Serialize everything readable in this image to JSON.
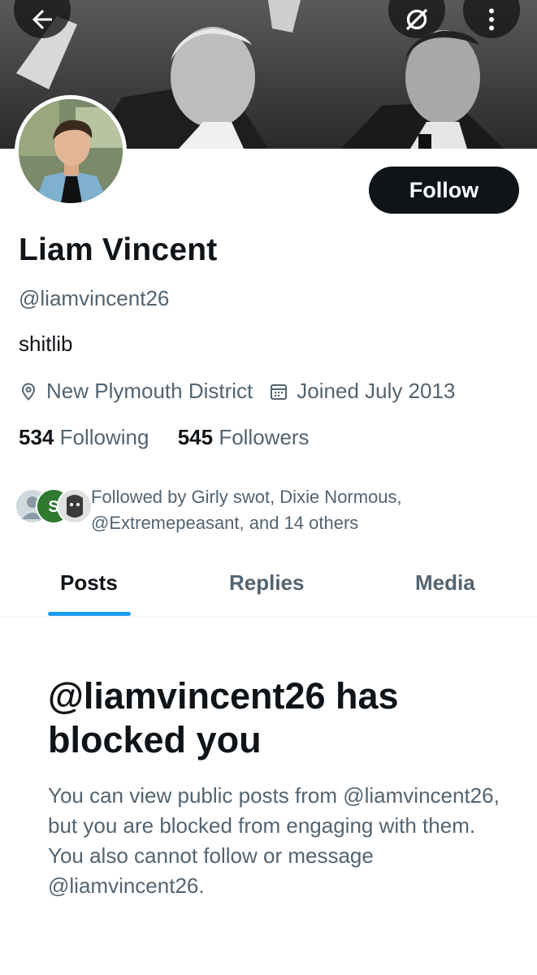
{
  "header": {
    "back_icon": "arrow-left-icon",
    "grok_icon": "grok-icon",
    "more_icon": "more-vertical-icon"
  },
  "profile": {
    "display_name": "Liam Vincent",
    "handle": "@liamvincent26",
    "bio": "shitlib",
    "location": "New Plymouth District",
    "joined": "Joined July 2013",
    "following_count": "534",
    "following_label": "Following",
    "followers_count": "545",
    "followers_label": "Followers",
    "follow_button": "Follow",
    "followed_by_text": "Followed by Girly swot, Dixie Normous, @Extremepeasant, and 14 others"
  },
  "tabs": [
    {
      "label": "Posts",
      "active": true
    },
    {
      "label": "Replies",
      "active": false
    },
    {
      "label": "Media",
      "active": false
    }
  ],
  "blocked": {
    "title": "@liamvincent26 has blocked you",
    "body": "You can view public posts from @liamvincent26, but you are blocked from engaging with them. You also cannot follow or message @liamvincent26."
  },
  "colors": {
    "text_primary": "#0f1419",
    "text_secondary": "#536471",
    "accent": "#1d9bf0",
    "button_dark": "#0f1419"
  }
}
